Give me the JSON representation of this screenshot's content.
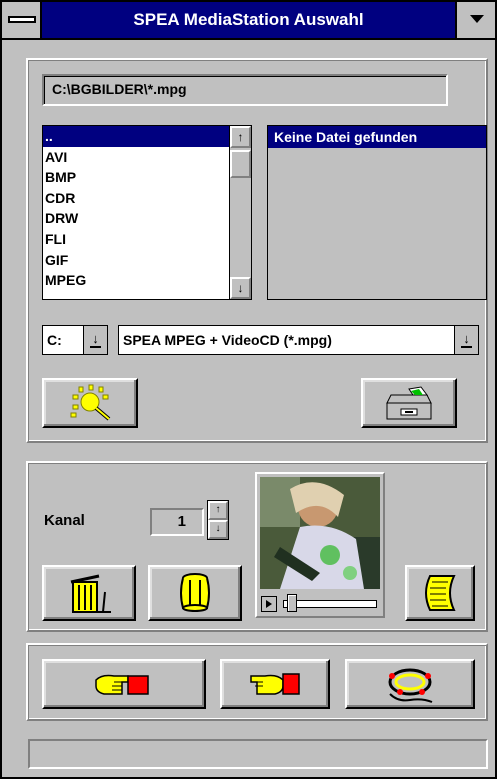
{
  "window": {
    "title": "SPEA MediaStation Auswahl"
  },
  "path": {
    "value": "C:\\BGBILDER\\*.mpg"
  },
  "directory_list": {
    "items": [
      "..",
      "AVI",
      "BMP",
      "CDR",
      "DRW",
      "FLI",
      "GIF",
      "MPEG"
    ],
    "selected_index": 0
  },
  "file_list": {
    "items": [
      "Keine Datei gefunden"
    ]
  },
  "drive_select": {
    "value": "C:"
  },
  "filter_select": {
    "value": "SPEA MPEG + VideoCD (*.mpg)"
  },
  "channel": {
    "label": "Kanal",
    "value": "1"
  },
  "icons": {
    "search": "sun-magnifier-icon",
    "open": "file-drawer-icon",
    "delete": "trash-can-icon",
    "barrel": "barrel-icon",
    "scroll": "scroll-icon",
    "ok": "hand-right-icon",
    "cancel": "hand-left-icon",
    "help": "lifebuoy-icon"
  },
  "colors": {
    "titlebar": "#000080",
    "face": "#c0c0c0",
    "selection": "#000080",
    "icon_yellow": "#ffff00"
  }
}
